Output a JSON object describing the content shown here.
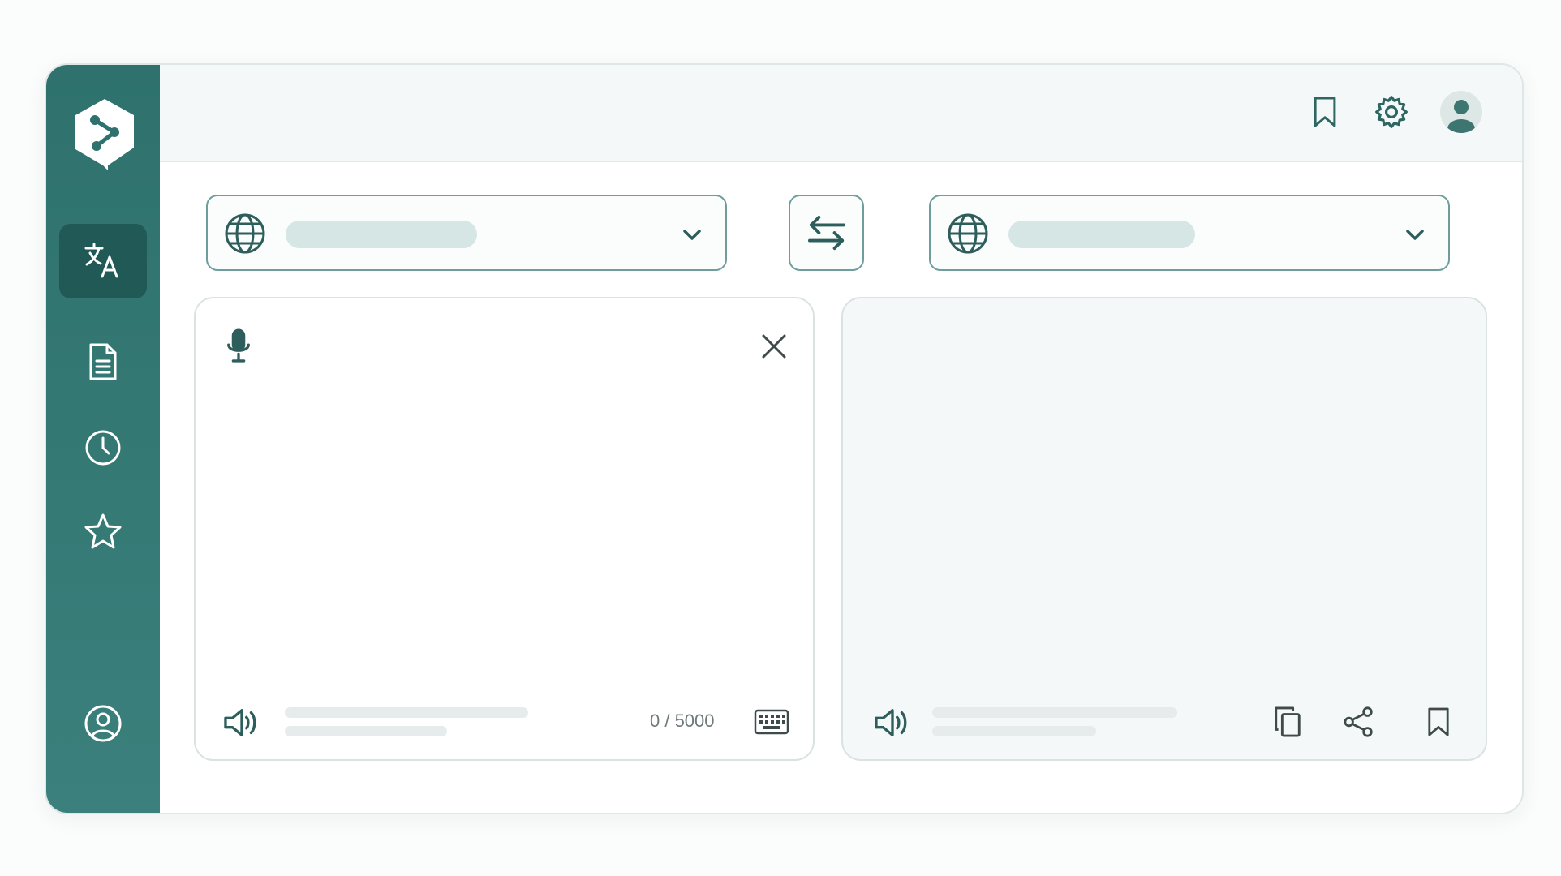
{
  "colors": {
    "sidebar": "#2e716d",
    "sidebar_active": "#205955",
    "accent": "#2d6663",
    "border": "#6e9e9b",
    "placeholder": "#d5e6e4"
  },
  "sidebar": {
    "logo_icon": "share-hexagon-icon",
    "items": [
      {
        "icon": "translate-icon",
        "active": true
      },
      {
        "icon": "document-icon",
        "active": false
      },
      {
        "icon": "history-clock-icon",
        "active": false
      },
      {
        "icon": "star-icon",
        "active": false
      }
    ],
    "bottom_icon": "user-circle-icon"
  },
  "header": {
    "icons": [
      "bookmark-icon",
      "gear-icon",
      "avatar-icon"
    ]
  },
  "source": {
    "language_label": "",
    "text_value": "",
    "char_count": "0 / 5000",
    "icons": [
      "microphone-icon",
      "close-icon",
      "speaker-icon",
      "keyboard-icon"
    ]
  },
  "target": {
    "language_label": "",
    "icons": [
      "speaker-icon",
      "copy-icon",
      "share-icon",
      "bookmark-icon"
    ]
  },
  "swap": {
    "icon": "swap-arrows-icon"
  }
}
